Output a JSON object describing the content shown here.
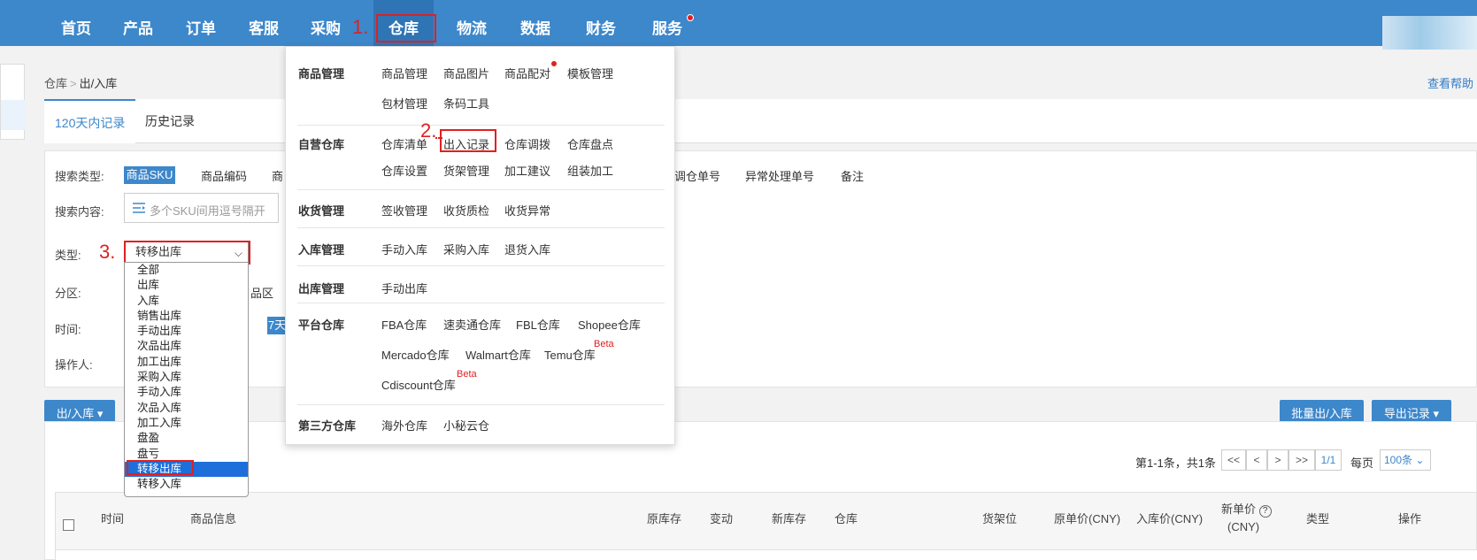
{
  "nav": {
    "items": [
      "首页",
      "产品",
      "订单",
      "客服",
      "采购",
      "仓库",
      "物流",
      "数据",
      "财务",
      "服务"
    ],
    "active": "仓库",
    "step1": "1."
  },
  "breadcrumb": {
    "root": "仓库",
    "sep": ">",
    "current": "出/入库"
  },
  "help": "查看帮助",
  "tabs": [
    "120天内记录",
    "历史记录"
  ],
  "filters": {
    "search_type_label": "搜索类型:",
    "search_type_selected": "商品SKU",
    "search_type_options": [
      "商品编码",
      "商",
      "调仓单号",
      "异常处理单号",
      "备注"
    ],
    "search_content_label": "搜索内容:",
    "search_placeholder": "多个SKU间用逗号隔开",
    "type_label": "类型:",
    "step3": "3.",
    "type_value": "转移出库",
    "zone_label": "分区:",
    "zone_fragment": "品区",
    "time_label": "时间:",
    "time_fragment": "7天",
    "operator_label": "操作人:"
  },
  "type_options": [
    "全部",
    "出库",
    "入库",
    "销售出库",
    "手动出库",
    "次品出库",
    "加工出库",
    "采购入库",
    "手动入库",
    "次品入库",
    "加工入库",
    "盘盈",
    "盘亏",
    "转移出库",
    "转移入库"
  ],
  "toolbar": {
    "inout": "出/入库",
    "batch": "批量出/入库",
    "export": "导出记录"
  },
  "pager": {
    "summary": "第1-1条，共1条",
    "first": "<<",
    "prev": "<",
    "next": ">",
    "last": ">>",
    "page": "1/1",
    "per_label": "每页",
    "per_value": "100条"
  },
  "table_headers": [
    "时间",
    "商品信息",
    "原库存",
    "变动",
    "新库存",
    "仓库",
    "货架位",
    "原单价(CNY)",
    "入库价(CNY)",
    "新单价",
    "(CNY)",
    "类型",
    "操作"
  ],
  "mega_menu": {
    "step2": "2.",
    "groups": [
      {
        "title": "商品管理",
        "items": [
          "商品管理",
          "商品图片",
          "商品配对",
          "模板管理",
          "包材管理",
          "条码工具"
        ]
      },
      {
        "title": "自营仓库",
        "items": [
          "仓库清单",
          "出入记录",
          "仓库调拨",
          "仓库盘点",
          "仓库设置",
          "货架管理",
          "加工建议",
          "组装加工"
        ]
      },
      {
        "title": "收货管理",
        "items": [
          "签收管理",
          "收货质检",
          "收货异常"
        ]
      },
      {
        "title": "入库管理",
        "items": [
          "手动入库",
          "采购入库",
          "退货入库"
        ]
      },
      {
        "title": "出库管理",
        "items": [
          "手动出库"
        ]
      },
      {
        "title": "平台仓库",
        "items": [
          "FBA仓库",
          "速卖通仓库",
          "FBL仓库",
          "Shopee仓库",
          "Mercado仓库",
          "Walmart仓库",
          "Temu仓库",
          "Cdiscount仓库"
        ]
      },
      {
        "title": "第三方仓库",
        "items": [
          "海外仓库",
          "小秘云仓"
        ]
      }
    ],
    "beta": "Beta"
  },
  "colors": {
    "nav_bg": "#3d87cb",
    "highlight": "#e02020",
    "accent": "#3d87cb"
  }
}
